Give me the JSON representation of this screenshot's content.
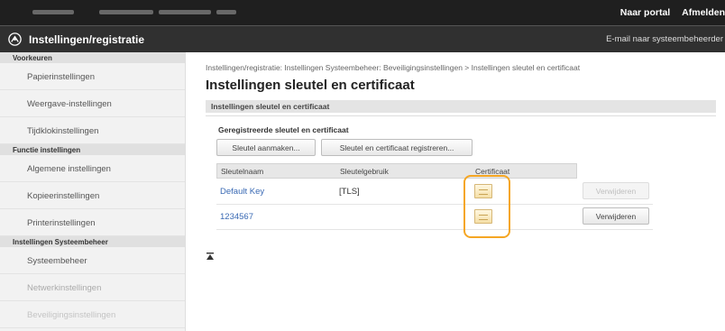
{
  "top_links": {
    "portal": "Naar portal",
    "logout": "Afmelden"
  },
  "header": {
    "title": "Instellingen/registratie",
    "email_link": "E-mail naar systeembeheerder"
  },
  "sidebar": {
    "sections": [
      {
        "heading": "Voorkeuren",
        "items": [
          "Papierinstellingen",
          "Weergave-instellingen",
          "Tijdklokinstellingen"
        ]
      },
      {
        "heading": "Functie instellingen",
        "items": [
          "Algemene instellingen",
          "Kopieerinstellingen",
          "Printerinstellingen"
        ]
      },
      {
        "heading": "Instellingen Systeembeheer",
        "items": [
          "Systeembeheer",
          "Netwerkinstellingen",
          "Beveiligingsinstellingen"
        ]
      }
    ]
  },
  "main": {
    "breadcrumb": "Instellingen/registratie: Instellingen Systeembeheer: Beveiligingsinstellingen > Instellingen sleutel en certificaat",
    "title": "Instellingen sleutel en certificaat",
    "section_title": "Instellingen sleutel en certificaat",
    "subsection_title": "Geregistreerde sleutel en certificaat",
    "buttons": {
      "generate_key": "Sleutel aanmaken...",
      "register": "Sleutel en certificaat registreren..."
    },
    "table": {
      "headers": [
        "Sleutelnaam",
        "Sleutelgebruik",
        "Certificaat"
      ],
      "rows": [
        {
          "name": "Default Key",
          "usage": "[TLS]",
          "cert_icon": "certificate-icon",
          "action": "Verwijderen",
          "action_enabled": false
        },
        {
          "name": "1234567",
          "usage": "",
          "cert_icon": "certificate-icon",
          "action": "Verwijderen",
          "action_enabled": true
        }
      ]
    },
    "highlight_color": "#f5a623"
  },
  "colors": {
    "topbar": "#1f1f1f",
    "header": "#303030",
    "link": "#3a6ab4"
  }
}
